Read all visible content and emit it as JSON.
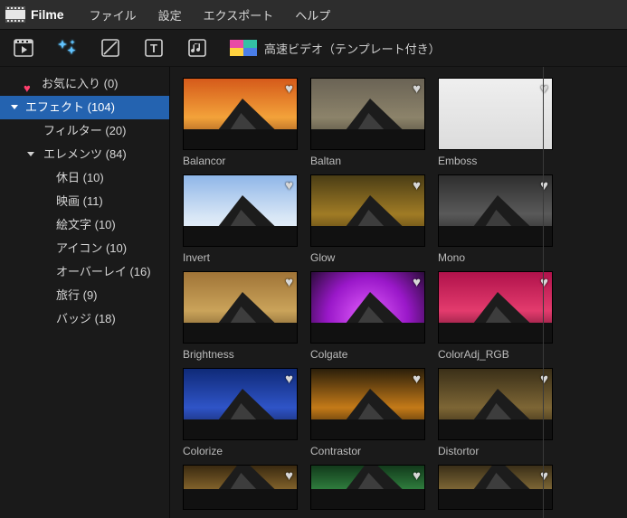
{
  "app": {
    "title": "Filme"
  },
  "menu": {
    "file": "ファイル",
    "settings": "設定",
    "export": "エクスポート",
    "help": "ヘルプ"
  },
  "toolbar": {
    "fast_video_label": "高速ビデオ（テンプレート付き）"
  },
  "sidebar": {
    "favorites_label": "お気に入り (0)",
    "effects_label": "エフェクト (104)",
    "filters_label": "フィルター (20)",
    "elements_label": "エレメンツ (84)",
    "holiday_label": "休日 (10)",
    "movie_label": "映画 (11)",
    "emoji_label": "絵文字 (10)",
    "icon_label": "アイコン (10)",
    "overlay_label": "オーバーレイ (16)",
    "travel_label": "旅行 (9)",
    "badge_label": "バッジ (18)"
  },
  "gallery": {
    "items": [
      {
        "label": "Balancor",
        "sky": "linear-gradient(180deg,#d55a1a 0%,#f3a23a 55%,#7b3c14 100%)"
      },
      {
        "label": "Baltan",
        "sky": "linear-gradient(180deg,#6a6355 0%,#8c836a 55%,#3f3a2e 100%)"
      },
      {
        "label": "Emboss",
        "sky": "linear-gradient(180deg,#efefef 0%,#dcdcdc 100%)"
      },
      {
        "label": "Invert",
        "sky": "linear-gradient(180deg,#8fb6e8 0%,#d9e7f6 60%,#f1f6fb 100%)"
      },
      {
        "label": "Glow",
        "sky": "linear-gradient(180deg,#4a3d15 0%,#a07b25 55%,#3c2d0c 100%)"
      },
      {
        "label": "Mono",
        "sky": "linear-gradient(180deg,#2e2e2e 0%,#595959 55%,#1c1c1c 100%)"
      },
      {
        "label": "Brightness",
        "sky": "linear-gradient(180deg,#a07437 0%,#caa35a 55%,#5f4521 100%)"
      },
      {
        "label": "Colgate",
        "sky": "radial-gradient(circle at 50% 65%,#e561ff 0%,#9a18c9 55%,#2b0b3a 100%)"
      },
      {
        "label": "ColorAdj_RGB",
        "sky": "linear-gradient(180deg,#b0124b 0%,#e33b6d 55%,#4f0822 100%)"
      },
      {
        "label": "Colorize",
        "sky": "linear-gradient(180deg,#0f2a78 0%,#2f54c7 55%,#0a1640 100%)"
      },
      {
        "label": "Contrastor",
        "sky": "linear-gradient(180deg,#2b1f0a 0%,#c47a18 55%,#120c04 100%)"
      },
      {
        "label": "Distortor",
        "sky": "linear-gradient(180deg,#3a2f18 0%,#7d6635 55%,#1e160a 100%)"
      },
      {
        "label": "",
        "sky": "linear-gradient(180deg,#3a2a10 0%,#82622b 55%,#1c1307 100%)"
      },
      {
        "label": "",
        "sky": "linear-gradient(180deg,#123a1b 0%,#2f7d3d 55%,#0a1c0d 100%)"
      },
      {
        "label": "",
        "sky": "linear-gradient(180deg,#3a2f18 0%,#7d6635 55%,#1e160a 100%)"
      }
    ]
  },
  "colors": {
    "accent_selected": "#2463b0",
    "favorite_heart": "#ff3f6d"
  }
}
